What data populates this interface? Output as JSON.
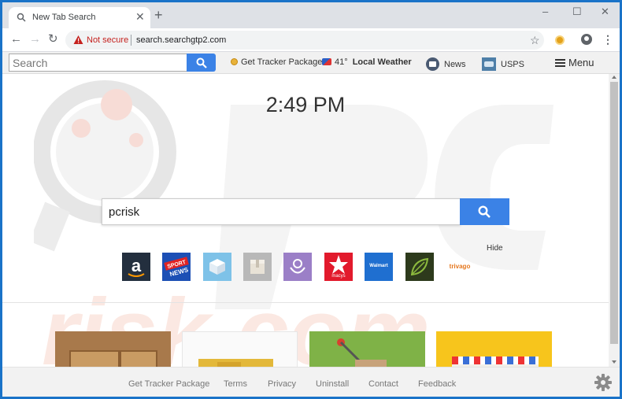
{
  "browser": {
    "tab_title": "New Tab Search",
    "tab_close": "✕",
    "new_tab": "+",
    "minimize": "–",
    "maximize": "☐",
    "close": "✕",
    "back": "←",
    "forward": "→",
    "reload": "↻",
    "security_label": "Not secure",
    "url": "search.searchgtp2.com",
    "bookmark_star": "☆",
    "menu_dots": "⋮"
  },
  "topbar": {
    "search_placeholder": "Search",
    "get_tracker_package": "Get Tracker Package",
    "temperature": "41°",
    "local_weather": "Local Weather",
    "news": "News",
    "usps": "USPS",
    "menu": "Menu"
  },
  "main": {
    "time": "2:49 PM",
    "search_value": "pcrisk",
    "hide": "Hide",
    "shortcuts": [
      {
        "name": "amazon",
        "color": "#232f3e"
      },
      {
        "name": "sport-news",
        "color": "#1c4fb5"
      },
      {
        "name": "package",
        "color": "#7ec2e8"
      },
      {
        "name": "box",
        "color": "#b8b8b8"
      },
      {
        "name": "flower",
        "color": "#9b7fc7"
      },
      {
        "name": "macys",
        "label": "macys",
        "color": "#e21a2c"
      },
      {
        "name": "walmart",
        "label": "Walmart",
        "color": "#1f6fd0"
      },
      {
        "name": "leaf",
        "color": "#2d3a1c"
      },
      {
        "name": "trivago",
        "label": "trivago"
      }
    ]
  },
  "footer": {
    "links": [
      "Get Tracker Package",
      "Terms",
      "Privacy",
      "Uninstall",
      "Contact",
      "Feedback"
    ]
  },
  "colors": {
    "accent_blue": "#3b82e6",
    "window_border": "#1a73c8"
  }
}
